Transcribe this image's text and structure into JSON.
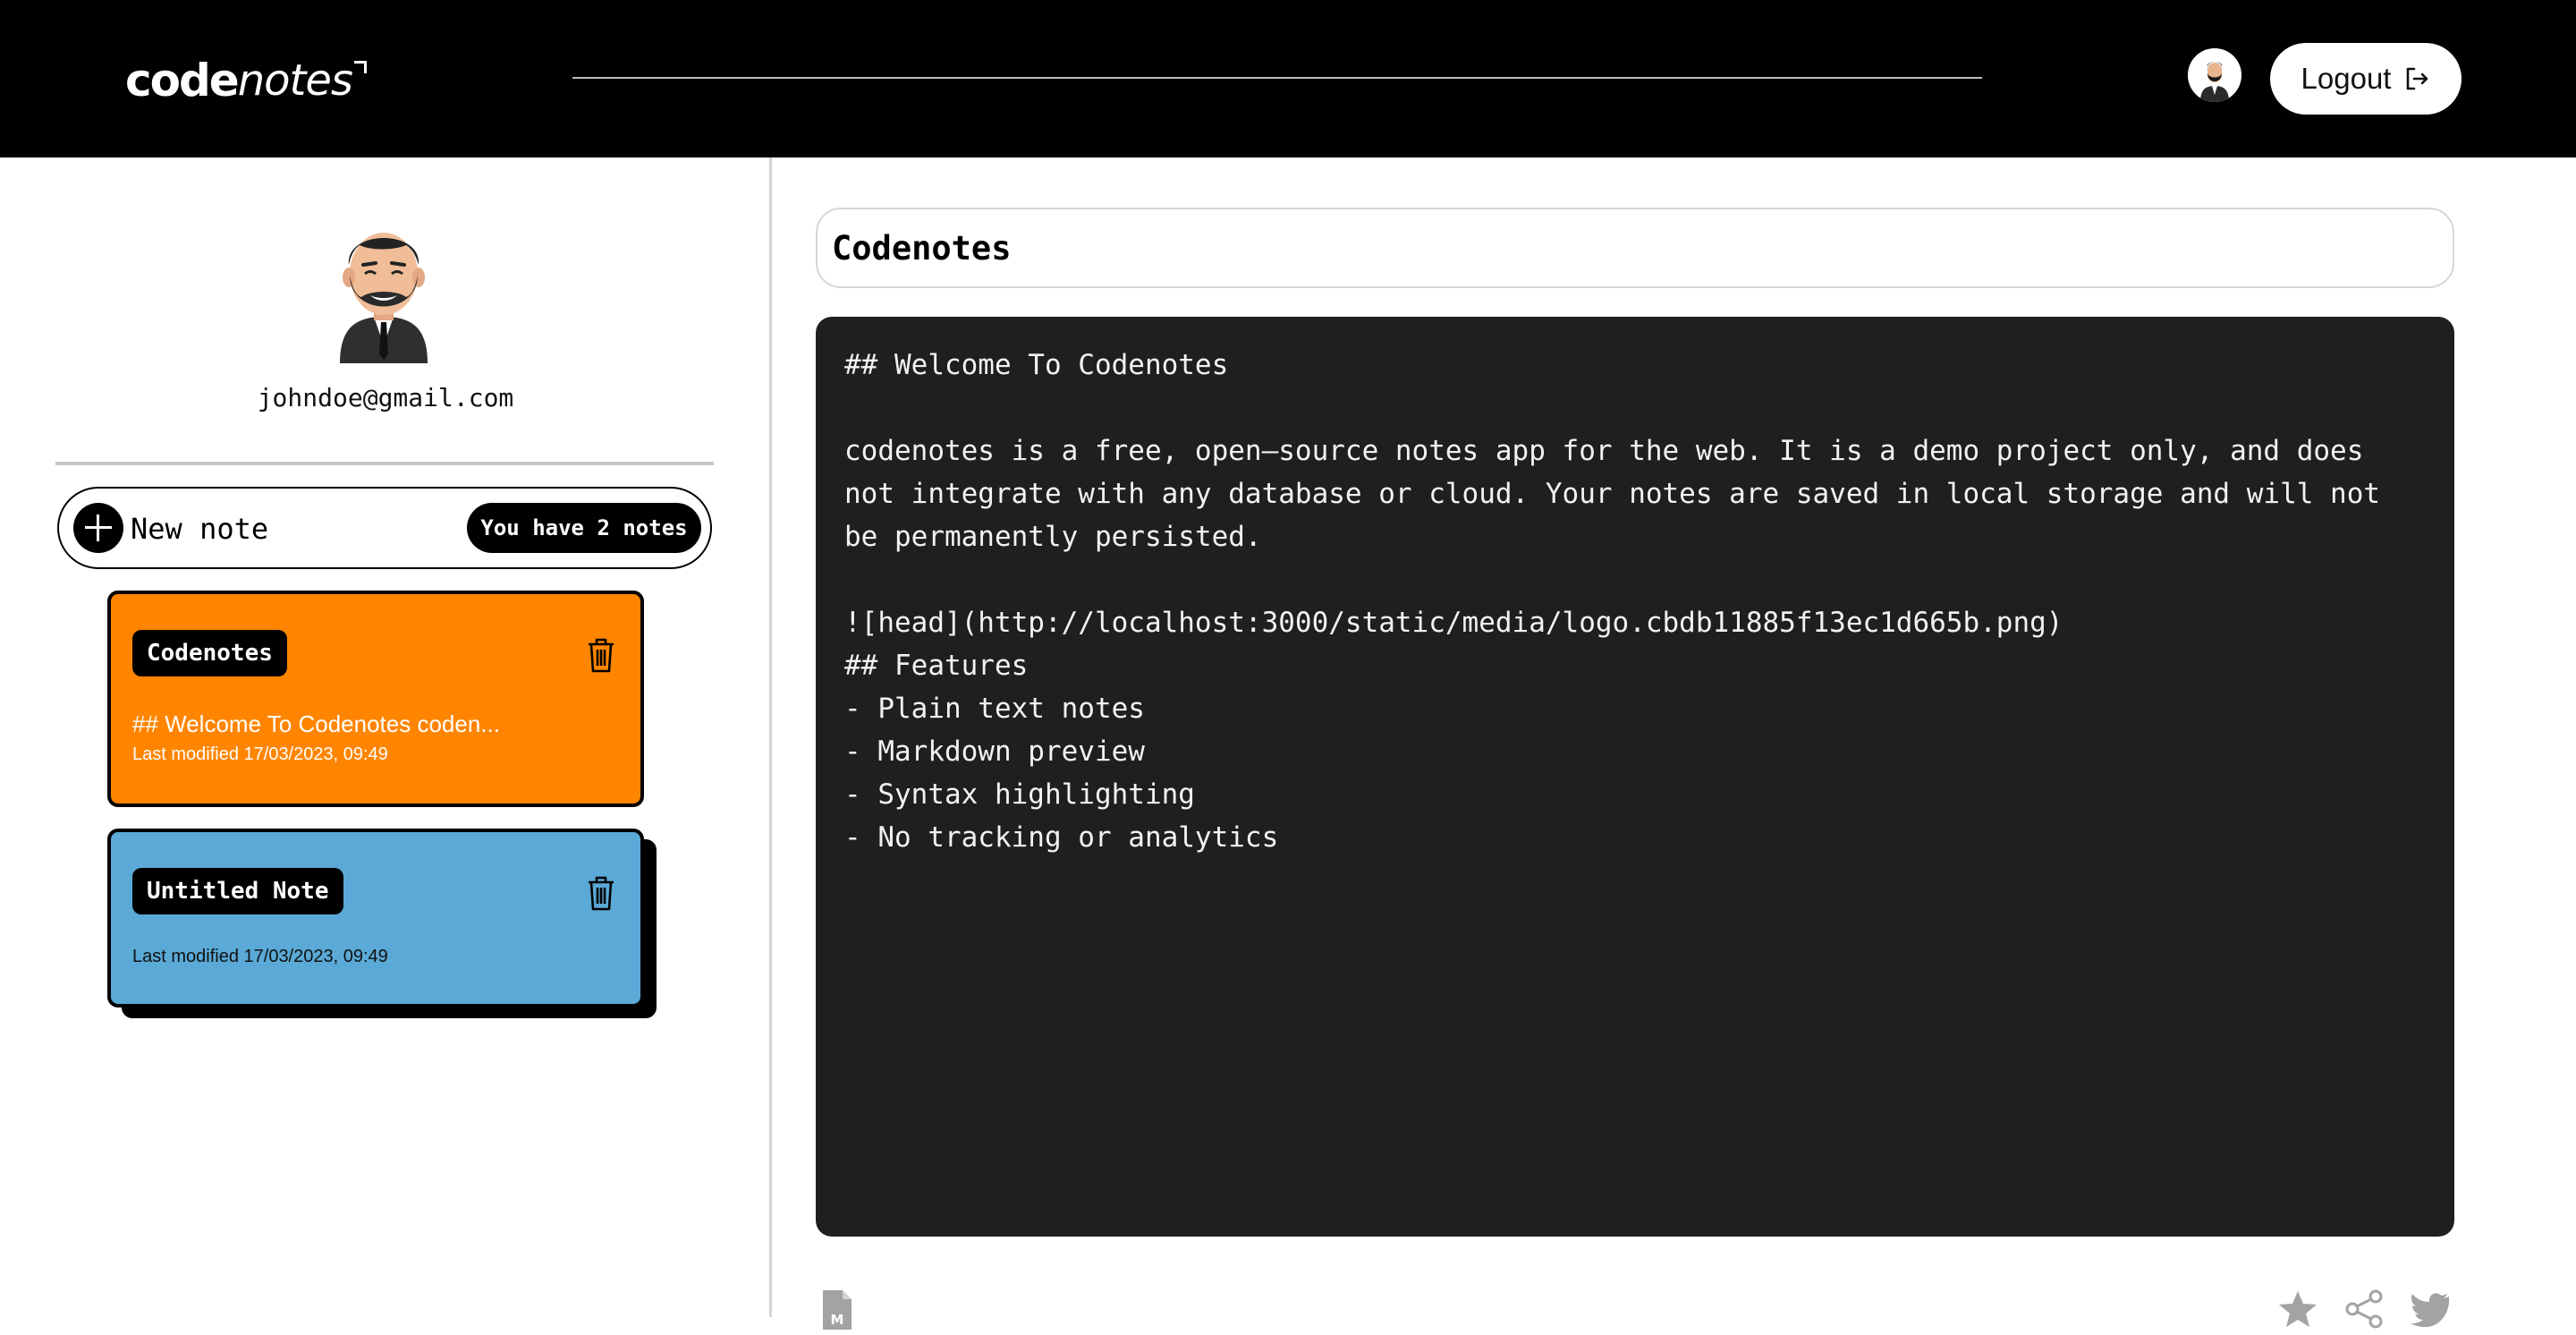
{
  "header": {
    "logo_bold": "code",
    "logo_light": "notes",
    "logout_label": "Logout"
  },
  "sidebar": {
    "email": "johndoe@gmail.com",
    "new_note_label": "New note",
    "notes_count_label": "You have 2 notes",
    "notes": [
      {
        "title": "Codenotes",
        "preview": "## Welcome To Codenotes coden...",
        "modified": "Last modified 17/03/2023, 09:49",
        "color": "#ff8500"
      },
      {
        "title": "Untitled Note",
        "preview": "",
        "modified": "Last modified 17/03/2023, 09:49",
        "color": "#5aa9d6"
      }
    ]
  },
  "editor": {
    "title_value": "Codenotes",
    "lines": [
      "## Welcome To Codenotes",
      "",
      "codenotes is a free, open—source notes app for the web. It is a demo project only, and does",
      "not integrate with any database or cloud. Your notes are saved in local storage and will not",
      "be permanently persisted.",
      "",
      "![head](http://localhost:3000/static/media/logo.cbdb11885f13ec1d665b.png)",
      "## Features",
      "- Plain text notes",
      "- Markdown preview",
      "- Syntax highlighting",
      "- No tracking or analytics"
    ]
  },
  "footer_icons": {
    "markdown": "markdown-file-icon",
    "star": "star-icon",
    "share": "share-icon",
    "twitter": "twitter-icon"
  },
  "colors": {
    "header_bg": "#000000",
    "editor_bg": "#1f1f1f",
    "note1": "#ff8500",
    "note2": "#5aa9d6"
  }
}
